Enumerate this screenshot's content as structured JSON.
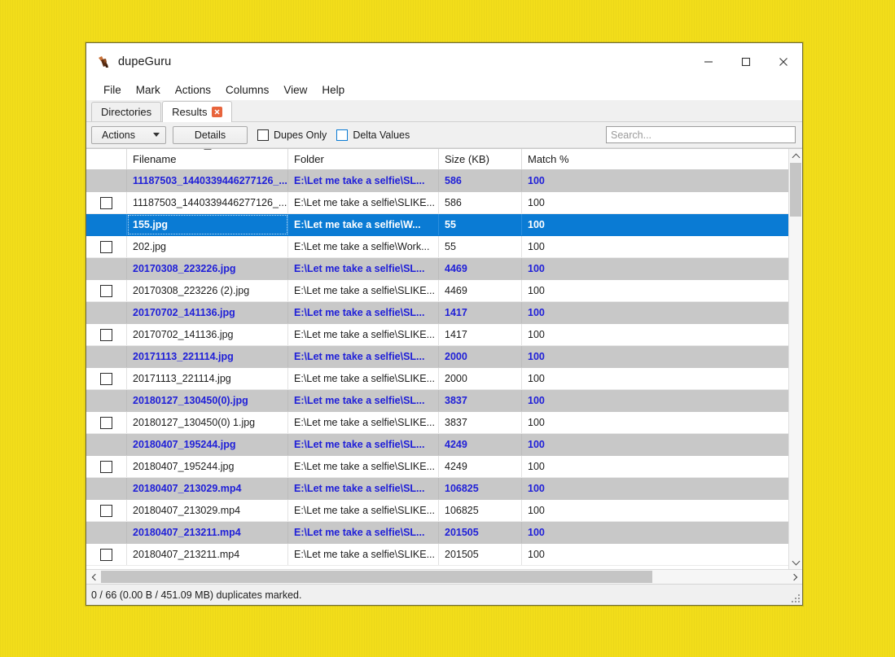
{
  "window": {
    "title": "dupeGuru",
    "app_icon": "dupeguru-icon",
    "controls": {
      "minimize": "—",
      "maximize": "☐",
      "close": "✕"
    }
  },
  "menubar": {
    "items": [
      "File",
      "Mark",
      "Actions",
      "Columns",
      "View",
      "Help"
    ]
  },
  "tabs": [
    {
      "label": "Directories",
      "active": false,
      "closable": false
    },
    {
      "label": "Results",
      "active": true,
      "closable": true,
      "close_glyph": "✕"
    }
  ],
  "toolbar": {
    "actions_label": "Actions",
    "details_label": "Details",
    "dupes_only_label": "Dupes Only",
    "dupes_only_checked": false,
    "delta_values_label": "Delta Values",
    "delta_values_checked": false,
    "search_placeholder": "Search...",
    "search_value": ""
  },
  "table": {
    "sort_column": "Filename",
    "sort_direction": "ascending",
    "columns": [
      "",
      "Filename",
      "Folder",
      "Size (KB)",
      "Match %"
    ],
    "rows": [
      {
        "kind": "group",
        "checked": null,
        "filename": "11187503_1440339446277126_...",
        "folder": "E:\\Let me take a selfie\\SL...",
        "size": "586",
        "match": "100"
      },
      {
        "kind": "dupe",
        "checked": false,
        "filename": "11187503_1440339446277126_...",
        "folder": "E:\\Let me take a selfie\\SLIKE...",
        "size": "586",
        "match": "100"
      },
      {
        "kind": "selected",
        "checked": null,
        "filename": "155.jpg",
        "folder": "E:\\Let me take a selfie\\W...",
        "size": "55",
        "match": "100"
      },
      {
        "kind": "dupe",
        "checked": false,
        "filename": "202.jpg",
        "folder": "E:\\Let me take a selfie\\Work...",
        "size": "55",
        "match": "100"
      },
      {
        "kind": "group",
        "checked": null,
        "filename": "20170308_223226.jpg",
        "folder": "E:\\Let me take a selfie\\SL...",
        "size": "4469",
        "match": "100"
      },
      {
        "kind": "dupe",
        "checked": false,
        "filename": "20170308_223226 (2).jpg",
        "folder": "E:\\Let me take a selfie\\SLIKE...",
        "size": "4469",
        "match": "100"
      },
      {
        "kind": "group",
        "checked": null,
        "filename": "20170702_141136.jpg",
        "folder": "E:\\Let me take a selfie\\SL...",
        "size": "1417",
        "match": "100"
      },
      {
        "kind": "dupe",
        "checked": false,
        "filename": "20170702_141136.jpg",
        "folder": "E:\\Let me take a selfie\\SLIKE...",
        "size": "1417",
        "match": "100"
      },
      {
        "kind": "group",
        "checked": null,
        "filename": "20171113_221114.jpg",
        "folder": "E:\\Let me take a selfie\\SL...",
        "size": "2000",
        "match": "100"
      },
      {
        "kind": "dupe",
        "checked": false,
        "filename": "20171113_221114.jpg",
        "folder": "E:\\Let me take a selfie\\SLIKE...",
        "size": "2000",
        "match": "100"
      },
      {
        "kind": "group",
        "checked": null,
        "filename": "20180127_130450(0).jpg",
        "folder": "E:\\Let me take a selfie\\SL...",
        "size": "3837",
        "match": "100"
      },
      {
        "kind": "dupe",
        "checked": false,
        "filename": "20180127_130450(0) 1.jpg",
        "folder": "E:\\Let me take a selfie\\SLIKE...",
        "size": "3837",
        "match": "100"
      },
      {
        "kind": "group",
        "checked": null,
        "filename": "20180407_195244.jpg",
        "folder": "E:\\Let me take a selfie\\SL...",
        "size": "4249",
        "match": "100"
      },
      {
        "kind": "dupe",
        "checked": false,
        "filename": "20180407_195244.jpg",
        "folder": "E:\\Let me take a selfie\\SLIKE...",
        "size": "4249",
        "match": "100"
      },
      {
        "kind": "group",
        "checked": null,
        "filename": "20180407_213029.mp4",
        "folder": "E:\\Let me take a selfie\\SL...",
        "size": "106825",
        "match": "100"
      },
      {
        "kind": "dupe",
        "checked": false,
        "filename": "20180407_213029.mp4",
        "folder": "E:\\Let me take a selfie\\SLIKE...",
        "size": "106825",
        "match": "100"
      },
      {
        "kind": "group",
        "checked": null,
        "filename": "20180407_213211.mp4",
        "folder": "E:\\Let me take a selfie\\SL...",
        "size": "201505",
        "match": "100"
      },
      {
        "kind": "dupe",
        "checked": false,
        "filename": "20180407_213211.mp4",
        "folder": "E:\\Let me take a selfie\\SLIKE...",
        "size": "201505",
        "match": "100"
      }
    ]
  },
  "statusbar": {
    "text": "0 / 66 (0.00 B / 451.09 MB) duplicates marked."
  },
  "colors": {
    "desktop_background": "#f2dd1a",
    "selection_blue": "#0a7bd4",
    "group_row_gray": "#c8c8c8",
    "group_text_blue": "#2020d8",
    "tab_close_orange": "#e8643c",
    "window_chrome": "#f0f0f0"
  }
}
